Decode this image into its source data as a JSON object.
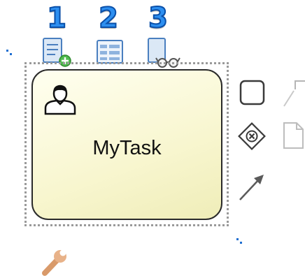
{
  "steps": [
    "1",
    "2",
    "3"
  ],
  "task": {
    "label": "MyTask",
    "type_icon": "user-icon"
  },
  "toolbar_icons": [
    "add-form-icon",
    "form-properties-icon",
    "form-preview-icon"
  ],
  "context_pad": [
    "task-shape-icon",
    "annotation-icon",
    "exclusive-gateway-icon",
    "data-object-icon",
    "connect-arrow-icon",
    "wrench-icon"
  ],
  "colors": {
    "step_number": "#2d8ff0",
    "task_fill": "#f8f6cf",
    "task_border": "#2a2a2a",
    "selection": "#9a9a9a",
    "handle": "#1f6fd1"
  }
}
